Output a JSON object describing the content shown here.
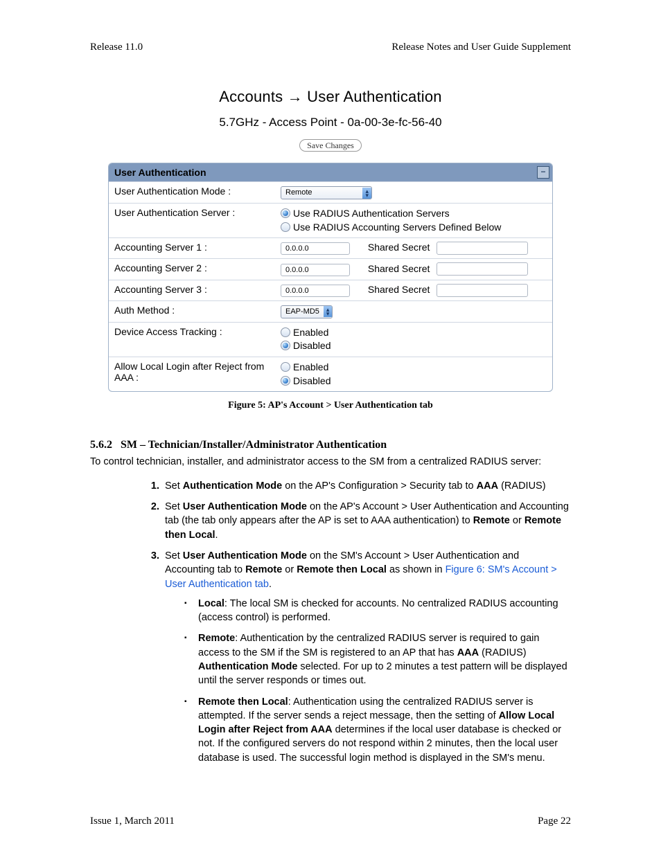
{
  "header": {
    "left": "Release 11.0",
    "right": "Release Notes and User Guide Supplement"
  },
  "figure": {
    "title_left": "Accounts",
    "title_right": "User Authentication",
    "subtitle": "5.7GHz - Access Point - 0a-00-3e-fc-56-40",
    "save_button": "Save Changes",
    "caption": "Figure 5: AP's Account > User Authentication tab"
  },
  "panel": {
    "title": "User Authentication",
    "mode_label": "User Authentication Mode :",
    "mode_value": "Remote",
    "server_label": "User Authentication Server :",
    "server_opt1": "Use RADIUS Authentication Servers",
    "server_opt2": "Use RADIUS Accounting Servers Defined Below",
    "acct_servers": [
      {
        "label": "Accounting Server 1 :",
        "ip": "0.0.0.0",
        "ss": "Shared Secret"
      },
      {
        "label": "Accounting Server 2 :",
        "ip": "0.0.0.0",
        "ss": "Shared Secret"
      },
      {
        "label": "Accounting Server 3 :",
        "ip": "0.0.0.0",
        "ss": "Shared Secret"
      }
    ],
    "auth_method_label": "Auth Method :",
    "auth_method_value": "EAP-MD5",
    "track_label": "Device Access Tracking :",
    "allow_label": "Allow Local Login after Reject from AAA :",
    "enabled": "Enabled",
    "disabled": "Disabled"
  },
  "section": {
    "num": "5.6.2",
    "title": "SM – Technician/Installer/Administrator Authentication",
    "intro": "To control technician, installer, and administrator access to the SM from a centralized RADIUS server:",
    "step1_a": "Set ",
    "step1_b": "Authentication Mode",
    "step1_c": " on the AP's Configuration > Security tab to ",
    "step1_d": "AAA",
    "step1_e": " (RADIUS)",
    "step2_a": "Set ",
    "step2_b": "User Authentication Mode",
    "step2_c": " on the AP's Account > User Authentication and Accounting tab (the tab only appears after the AP is set to AAA authentication) to ",
    "step2_d": "Remote",
    "step2_e": " or ",
    "step2_f": "Remote then Local",
    "step2_g": ".",
    "step3_a": "Set ",
    "step3_b": "User Authentication Mode",
    "step3_c": " on the SM's Account > User Authentication and Accounting tab to ",
    "step3_d": "Remote",
    "step3_e": " or ",
    "step3_f": "Remote then Local",
    "step3_g": " as shown in ",
    "step3_link": "Figure 6: SM's Account > User Authentication tab",
    "step3_h": ".",
    "b_local_t": "Local",
    "b_local": ": The local SM is checked for accounts. No centralized RADIUS accounting (access control) is performed.",
    "b_remote_t": "Remote",
    "b_remote_1": ": Authentication by the centralized RADIUS server is required to gain access to the SM if the SM is registered to an AP that has ",
    "b_remote_b1": "AAA",
    "b_remote_2": " (RADIUS) ",
    "b_remote_b2": "Authentication Mode",
    "b_remote_3": " selected. For up to 2 minutes a test pattern will be displayed until the server responds or times out.",
    "b_rtl_t": "Remote then Local",
    "b_rtl_1": ": Authentication using the centralized RADIUS server is attempted. If the server sends a reject message, then the setting of ",
    "b_rtl_b1": "Allow Local Login after Reject from AAA",
    "b_rtl_2": " determines if the local user database is checked or not. If the configured servers do not respond within 2 minutes, then the local user database is used. The successful login method is displayed in the SM's menu."
  },
  "footer": {
    "left": "Issue 1, March 2011",
    "right": "Page 22"
  }
}
